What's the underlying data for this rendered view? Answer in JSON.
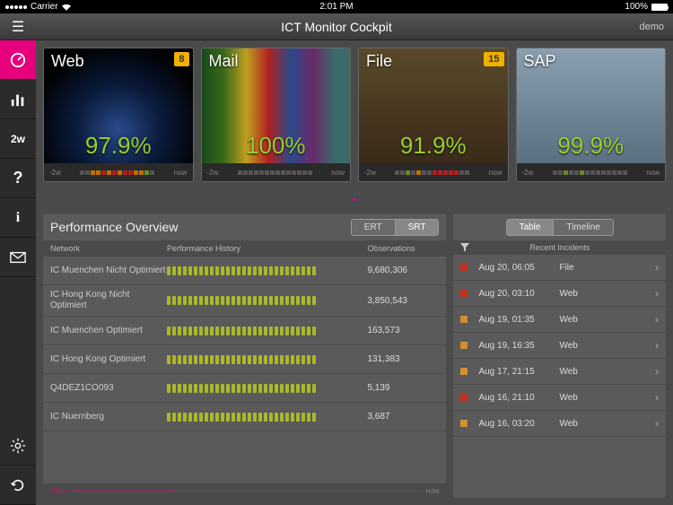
{
  "statusbar": {
    "carrier": "Carrier",
    "time": "2:01 PM",
    "battery": "100%"
  },
  "header": {
    "title": "ICT Monitor Cockpit",
    "user": "demo"
  },
  "sidebar": {
    "items": [
      {
        "name": "dashboard-icon",
        "label": "",
        "active": true
      },
      {
        "name": "stats-icon",
        "label": ""
      },
      {
        "name": "period-2w",
        "label": "2w"
      },
      {
        "name": "help-icon",
        "label": "?"
      },
      {
        "name": "info-icon",
        "label": "i"
      },
      {
        "name": "mail-icon",
        "label": ""
      }
    ],
    "bottom": [
      {
        "name": "settings-icon",
        "label": ""
      },
      {
        "name": "refresh-icon",
        "label": ""
      }
    ]
  },
  "tiles": [
    {
      "title": "Web",
      "pct": "97.9%",
      "badge": "8",
      "range_l": "-2w",
      "range_r": "now"
    },
    {
      "title": "Mail",
      "pct": "100%",
      "badge": "",
      "range_l": "-2w",
      "range_r": "now"
    },
    {
      "title": "File",
      "pct": "91.9%",
      "badge": "15",
      "range_l": "-2w",
      "range_r": "now"
    },
    {
      "title": "SAP",
      "pct": "99.9%",
      "badge": "",
      "range_l": "-2w",
      "range_r": "now"
    }
  ],
  "overview": {
    "title": "Performance Overview",
    "tabs": {
      "ert": "ERT",
      "srt": "SRT"
    },
    "cols": {
      "c1": "Network",
      "c2": "Performance History",
      "c3": "Observations"
    },
    "rows": [
      {
        "net": "IC Muenchen Nicht Optimiert",
        "obs": "9,680,306"
      },
      {
        "net": "IC Hong Kong Nicht Optimiert",
        "obs": "3,850,543"
      },
      {
        "net": "IC Muenchen Optimiert",
        "obs": "163,573"
      },
      {
        "net": "IC Hong Kong Optimiert",
        "obs": "131,383"
      },
      {
        "net": "Q4DEZ1CO093",
        "obs": "5,139"
      },
      {
        "net": "IC Nuernberg",
        "obs": "3,687"
      }
    ],
    "foot_l": "-24h",
    "foot_r": "now"
  },
  "incidents": {
    "tabs": {
      "table": "Table",
      "timeline": "Timeline"
    },
    "head": "Recent Incidents",
    "rows": [
      {
        "sev": "r",
        "time": "Aug 20, 06:05",
        "type": "File"
      },
      {
        "sev": "r",
        "time": "Aug 20, 03:10",
        "type": "Web"
      },
      {
        "sev": "o",
        "time": "Aug 19, 01:35",
        "type": "Web"
      },
      {
        "sev": "o",
        "time": "Aug 19, 16:35",
        "type": "Web"
      },
      {
        "sev": "o",
        "time": "Aug 17, 21:15",
        "type": "Web"
      },
      {
        "sev": "r",
        "time": "Aug 16, 21:10",
        "type": "Web"
      },
      {
        "sev": "o",
        "time": "Aug 16, 03:20",
        "type": "Web"
      }
    ]
  }
}
